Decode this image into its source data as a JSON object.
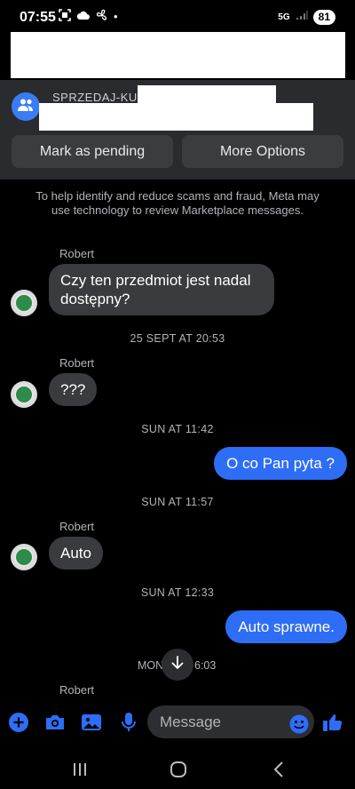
{
  "status_bar": {
    "time": "07:55",
    "network": "5G",
    "battery": "81"
  },
  "marketplace": {
    "title": "SPRZEDAJ-KUP",
    "mark_pending_label": "Mark as pending",
    "more_options_label": "More Options"
  },
  "chat": {
    "notice": "To help identify and reduce scams and fraud, Meta may use technology to review Marketplace messages.",
    "messages": [
      {
        "sender": "Robert",
        "text": "Czy ten przedmiot jest nadal dostępny?"
      },
      {
        "stamp": "25 SEPT AT 20:53"
      },
      {
        "sender": "Robert",
        "text": "???"
      },
      {
        "stamp": "SUN AT 11:42"
      },
      {
        "text": "O co Pan pyta ?"
      },
      {
        "stamp": "SUN AT 11:57"
      },
      {
        "sender": "Robert",
        "text": "Auto"
      },
      {
        "stamp": "SUN AT 12:33"
      },
      {
        "text": "Auto sprawne."
      },
      {
        "stamp_left": "MON",
        "stamp_right": "6:03"
      },
      {
        "sender": "Robert"
      }
    ]
  },
  "composer": {
    "placeholder": "Message"
  },
  "colors": {
    "accent": "#2e6df5",
    "incoming_bubble": "#3a3b3e",
    "background": "#000000"
  },
  "icons": [
    "plus-icon",
    "camera-icon",
    "image-icon",
    "microphone-icon",
    "emoji-icon",
    "thumbs-up-icon",
    "arrow-down-icon",
    "recent-apps-icon",
    "home-icon",
    "back-icon"
  ]
}
